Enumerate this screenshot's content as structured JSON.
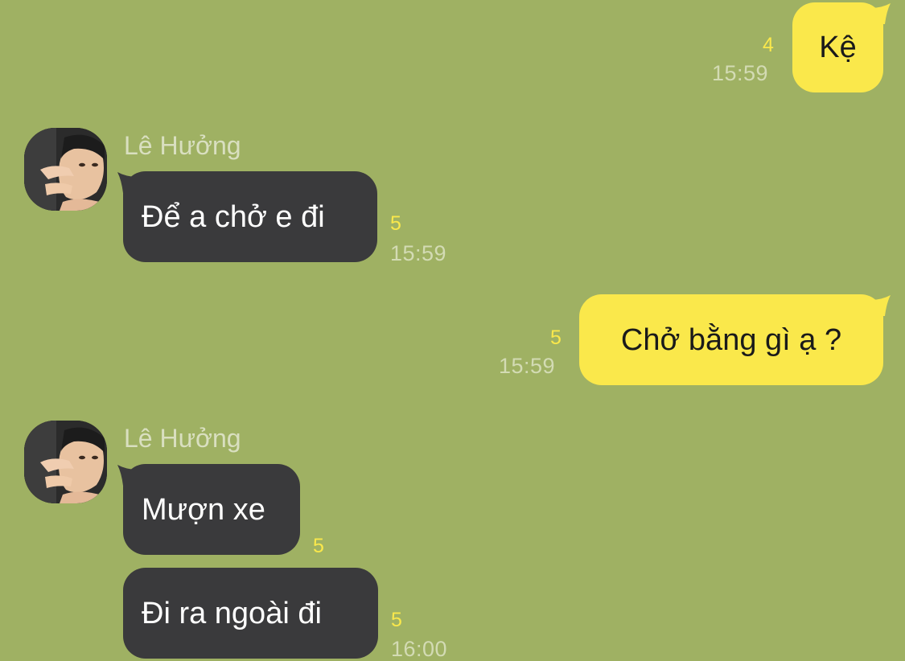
{
  "conversation": {
    "messages": [
      {
        "direction": "outgoing",
        "text": "Kệ",
        "unread": "4",
        "time": "15:59"
      },
      {
        "direction": "incoming",
        "sender": "Lê Hưởng",
        "text": "Để a chở e đi",
        "unread": "5",
        "time": "15:59"
      },
      {
        "direction": "outgoing",
        "text": "Chở bằng gì ạ ?",
        "unread": "5",
        "time": "15:59"
      },
      {
        "direction": "incoming",
        "sender": "Lê Hưởng",
        "text": "Mượn xe",
        "unread": "5"
      },
      {
        "direction": "incoming",
        "text": "Đi ra ngoài đi",
        "unread": "5",
        "time": "16:00"
      }
    ]
  },
  "colors": {
    "background": "#9fb163",
    "outgoing_bubble": "#fae84b",
    "incoming_bubble": "#3a3a3c",
    "unread_count": "#fae84b",
    "timestamp": "#d3dbb4"
  },
  "icons": {
    "avatar": "profile-photo"
  }
}
